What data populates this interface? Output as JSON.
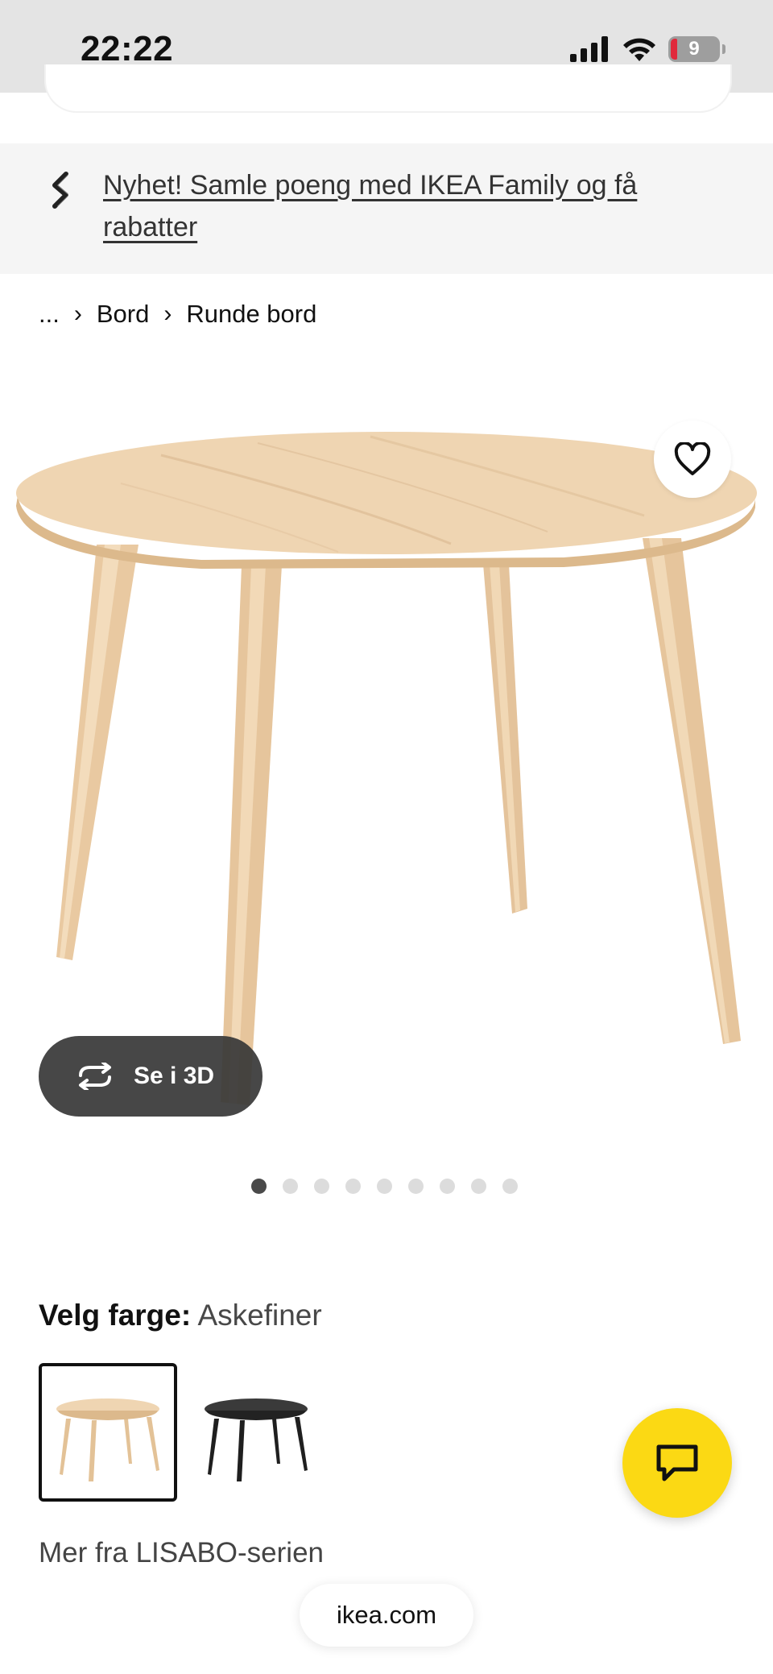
{
  "status_bar": {
    "time": "22:22",
    "battery_level": "9"
  },
  "banner": {
    "text": "Nyhet! Samle poeng med IKEA Family og få rabatter"
  },
  "breadcrumb": {
    "ellipsis": "...",
    "items": [
      "Bord",
      "Runde bord"
    ]
  },
  "product": {
    "view_3d_label": "Se i 3D",
    "image_count": 9,
    "active_image": 1
  },
  "color_selector": {
    "label": "Velg farge:",
    "selected_value": "Askefiner",
    "options": [
      {
        "name": "Askefiner",
        "color": "#e8c9a0",
        "selected": true
      },
      {
        "name": "Svart",
        "color": "#2a2a2a",
        "selected": false
      }
    ]
  },
  "series": {
    "text": "Mer fra LISABO-serien"
  },
  "browser": {
    "url": "ikea.com"
  },
  "colors": {
    "chat_button": "#fbd914",
    "wood": "#eed2ae"
  }
}
